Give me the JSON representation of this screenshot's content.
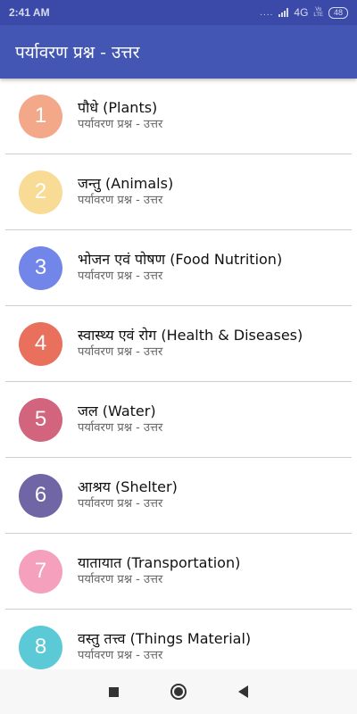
{
  "status_bar": {
    "time": "2:41 AM",
    "dots": "....",
    "network": "4G",
    "lte_top": "Vo",
    "lte_bottom": "LTE",
    "battery": "48"
  },
  "app_bar": {
    "title": "पर्यावरण प्रश्न - उत्तर"
  },
  "list": {
    "items": [
      {
        "number": "1",
        "title": "पौधे (Plants)",
        "subtitle": "पर्यावरण प्रश्न - उत्तर",
        "color": "#f3a88a"
      },
      {
        "number": "2",
        "title": "जन्तु (Animals)",
        "subtitle": "पर्यावरण प्रश्न - उत्तर",
        "color": "#f8dc96"
      },
      {
        "number": "3",
        "title": "भोजन एवं पोषण (Food Nutrition)",
        "subtitle": "पर्यावरण प्रश्न - उत्तर",
        "color": "#7186e8"
      },
      {
        "number": "4",
        "title": "स्वास्थ्य एवं रोग (Health & Diseases)",
        "subtitle": "पर्यावरण प्रश्न - उत्तर",
        "color": "#e9705c"
      },
      {
        "number": "5",
        "title": "जल (Water)",
        "subtitle": "पर्यावरण प्रश्न - उत्तर",
        "color": "#d2657d"
      },
      {
        "number": "6",
        "title": "आश्रय (Shelter)",
        "subtitle": "पर्यावरण प्रश्न - उत्तर",
        "color": "#7166a5"
      },
      {
        "number": "7",
        "title": "यातायात (Transportation)",
        "subtitle": "पर्यावरण प्रश्न - उत्तर",
        "color": "#f5a0bc"
      },
      {
        "number": "8",
        "title": "वस्तु तत्त्व (Things Material)",
        "subtitle": "पर्यावरण प्रश्न - उत्तर",
        "color": "#5cc9d6"
      }
    ]
  },
  "nav_bar": {
    "recent_icon": "square-recents-icon",
    "home_icon": "circle-home-icon",
    "back_icon": "triangle-back-icon"
  }
}
